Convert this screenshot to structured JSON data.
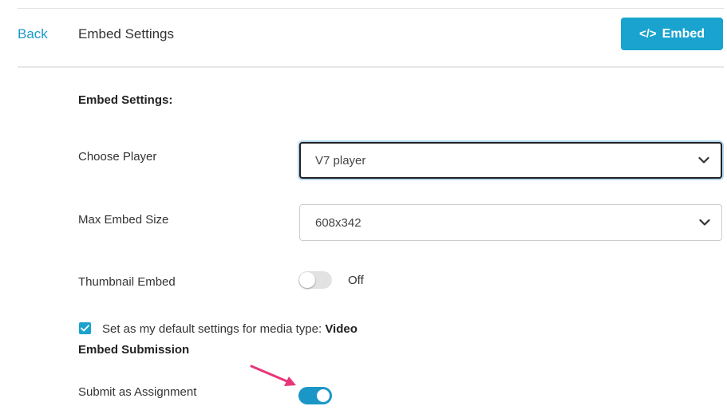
{
  "header": {
    "back_label": "Back",
    "title": "Embed Settings",
    "embed_button": {
      "icon": "code-icon",
      "icon_glyph": "</>",
      "label": "Embed"
    }
  },
  "settings": {
    "section_title": "Embed Settings:",
    "choose_player": {
      "label": "Choose Player",
      "selected": "V7 player"
    },
    "max_embed_size": {
      "label": "Max Embed Size",
      "selected": "608x342"
    },
    "thumbnail_embed": {
      "label": "Thumbnail Embed",
      "state": "Off"
    },
    "default_settings": {
      "checked": true,
      "text": "Set as my default settings for media type: ",
      "media_type": "Video"
    }
  },
  "submission": {
    "section_title": "Embed Submission",
    "submit_as_assignment": {
      "label": "Submit as Assignment",
      "enabled": true
    }
  },
  "colors": {
    "accent": "#1aa3cf",
    "link": "#1a9ac9",
    "annotation_arrow": "#e8357a"
  }
}
